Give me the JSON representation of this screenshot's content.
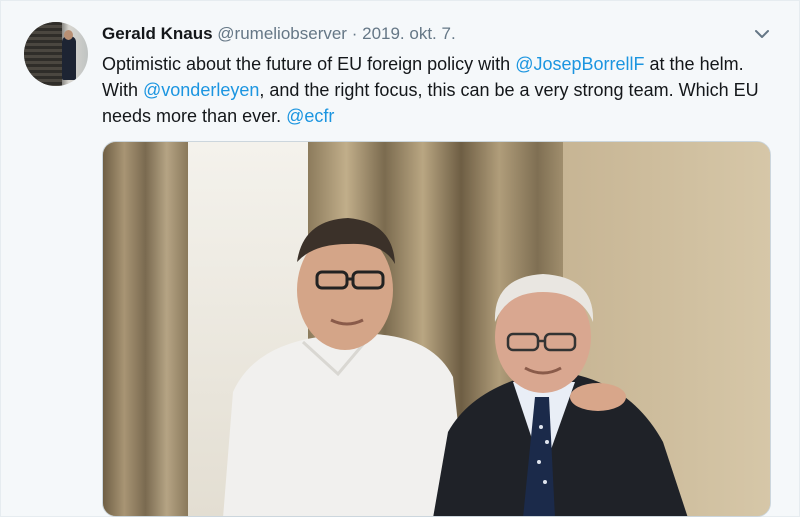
{
  "tweet": {
    "author_name": "Gerald Knaus",
    "handle": "@rumeliobserver",
    "separator": "·",
    "date": "2019. okt. 7.",
    "text_part1": "Optimistic about the future of EU foreign policy with ",
    "mention1": "@JosepBorrellF",
    "text_part2": " at the helm. With ",
    "mention2": "@vonderleyen",
    "text_part3": ", and the right focus, this can be a very strong team. Which EU needs more than ever. ",
    "mention3": "@ecfr"
  },
  "icons": {
    "menu": "chevron-down-icon"
  },
  "colors": {
    "link": "#1b95e0",
    "secondary_text": "#657786",
    "primary_text": "#14171a",
    "background": "#f5f8fa"
  }
}
